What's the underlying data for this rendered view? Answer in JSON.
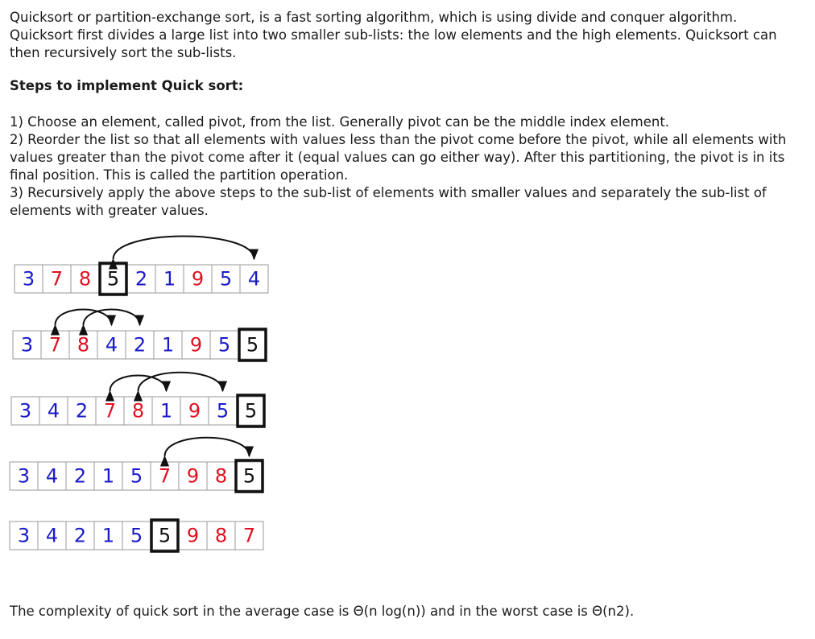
{
  "intro": "Quicksort or partition-exchange sort, is a fast sorting algorithm, which is using divide and conquer algorithm. Quicksort first divides a large list into two smaller sub-lists: the low elements and the high elements. Quicksort can then recursively sort the sub-lists.",
  "steps_heading": "Steps to implement Quick sort:",
  "steps": [
    "1) Choose an element, called pivot, from the list. Generally pivot can be the middle index element.",
    "2) Reorder the list so that all elements with values less than the pivot come before the pivot, while all elements with values greater than the pivot come after it (equal values can go either way). After this partitioning, the pivot is in its final position. This is called the partition operation.",
    "3) Recursively apply the above steps to the sub-list of elements with smaller values and separately the sub-list of elements with greater values."
  ],
  "complexity": "The complexity of quick sort in the average case is Θ(n log(n)) and in the worst case is Θ(n2).",
  "colors": {
    "low": "#1a1acc",
    "high": "#e01020",
    "pivot": "#111111",
    "cell_border": "#9a9a9a",
    "arrow": "#111111"
  },
  "rows": [
    {
      "values": [
        "3",
        "7",
        "8",
        "5",
        "2",
        "1",
        "9",
        "5",
        "4"
      ],
      "kinds": [
        "low",
        "high",
        "high",
        "pivot",
        "low",
        "low",
        "high",
        "low",
        "low"
      ],
      "pivot_index": 3,
      "swaps": [
        [
          3,
          8
        ]
      ]
    },
    {
      "values": [
        "3",
        "7",
        "8",
        "4",
        "2",
        "1",
        "9",
        "5",
        "5"
      ],
      "kinds": [
        "low",
        "high",
        "high",
        "low",
        "low",
        "low",
        "high",
        "low",
        "pivot"
      ],
      "pivot_index": 8,
      "swaps": [
        [
          1,
          3
        ],
        [
          2,
          4
        ]
      ]
    },
    {
      "values": [
        "3",
        "4",
        "2",
        "7",
        "8",
        "1",
        "9",
        "5",
        "5"
      ],
      "kinds": [
        "low",
        "low",
        "low",
        "high",
        "high",
        "low",
        "high",
        "low",
        "pivot"
      ],
      "pivot_index": 8,
      "swaps": [
        [
          3,
          5
        ],
        [
          4,
          7
        ]
      ]
    },
    {
      "values": [
        "3",
        "4",
        "2",
        "1",
        "5",
        "7",
        "9",
        "8",
        "5"
      ],
      "kinds": [
        "low",
        "low",
        "low",
        "low",
        "low",
        "high",
        "high",
        "high",
        "pivot"
      ],
      "pivot_index": 8,
      "swaps": [
        [
          5,
          8
        ]
      ]
    },
    {
      "values": [
        "3",
        "4",
        "2",
        "1",
        "5",
        "5",
        "9",
        "8",
        "7"
      ],
      "kinds": [
        "low",
        "low",
        "low",
        "low",
        "low",
        "pivot",
        "high",
        "high",
        "high"
      ],
      "pivot_index": 5,
      "swaps": []
    }
  ]
}
